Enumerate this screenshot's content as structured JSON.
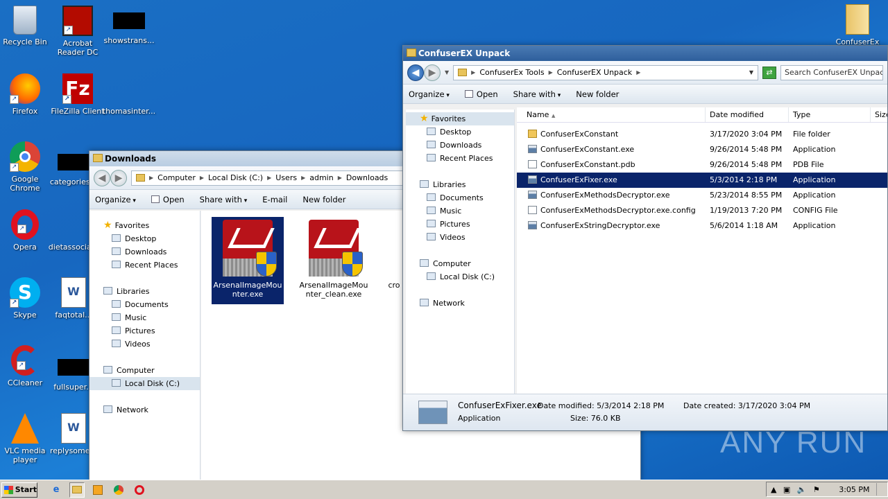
{
  "desktop": {
    "icons": [
      {
        "label": "Recycle Bin"
      },
      {
        "label": "Acrobat Reader DC"
      },
      {
        "label": "showstrans..."
      },
      {
        "label": "Firefox"
      },
      {
        "label": "FileZilla Client"
      },
      {
        "label": "thomasinter..."
      },
      {
        "label": "Google Chrome"
      },
      {
        "label": "categories..."
      },
      {
        "label": "Opera"
      },
      {
        "label": "dietassocia..."
      },
      {
        "label": "Skype"
      },
      {
        "label": "faqtotal..."
      },
      {
        "label": "CCleaner"
      },
      {
        "label": "fullsuper..."
      },
      {
        "label": "VLC media player"
      },
      {
        "label": "replysome..."
      },
      {
        "label": "ConfuserEx"
      }
    ]
  },
  "downloads_window": {
    "title": "Downloads",
    "breadcrumb": [
      "Computer",
      "Local Disk (C:)",
      "Users",
      "admin",
      "Downloads"
    ],
    "toolbar": {
      "organize": "Organize",
      "open": "Open",
      "share_with": "Share with",
      "email": "E-mail",
      "new_folder": "New folder"
    },
    "nav": {
      "favorites": "Favorites",
      "desktop": "Desktop",
      "downloads": "Downloads",
      "recent_places": "Recent Places",
      "libraries": "Libraries",
      "documents": "Documents",
      "music": "Music",
      "pictures": "Pictures",
      "videos": "Videos",
      "computer": "Computer",
      "local_disk": "Local Disk (C:)",
      "network": "Network"
    },
    "files": [
      {
        "name": "ArsenalImageMounter.exe"
      },
      {
        "name": "ArsenalImageMounter_clean.exe"
      },
      {
        "name": "cro"
      }
    ]
  },
  "confuser_window": {
    "title": "ConfuserEX Unpack",
    "breadcrumb": [
      "ConfuserEx Tools",
      "ConfuserEX Unpack"
    ],
    "search_placeholder": "Search ConfuserEX Unpack",
    "toolbar": {
      "organize": "Organize",
      "open": "Open",
      "share_with": "Share with",
      "new_folder": "New folder"
    },
    "nav": {
      "favorites": "Favorites",
      "desktop": "Desktop",
      "downloads": "Downloads",
      "recent_places": "Recent Places",
      "libraries": "Libraries",
      "documents": "Documents",
      "music": "Music",
      "pictures": "Pictures",
      "videos": "Videos",
      "computer": "Computer",
      "local_disk": "Local Disk (C:)",
      "network": "Network"
    },
    "columns": {
      "name": "Name",
      "date_modified": "Date modified",
      "type": "Type",
      "size": "Size"
    },
    "rows": [
      {
        "name": "ConfuserExConstant",
        "date": "3/17/2020 3:04 PM",
        "type": "File folder",
        "icon": "folder-icon"
      },
      {
        "name": "ConfuserExConstant.exe",
        "date": "9/26/2014 5:48 PM",
        "type": "Application",
        "icon": "app-icon"
      },
      {
        "name": "ConfuserExConstant.pdb",
        "date": "9/26/2014 5:48 PM",
        "type": "PDB File",
        "icon": "file-icon"
      },
      {
        "name": "ConfuserExFixer.exe",
        "date": "5/3/2014 2:18 PM",
        "type": "Application",
        "icon": "app-icon",
        "selected": true
      },
      {
        "name": "ConfuserExMethodsDecryptor.exe",
        "date": "5/23/2014 8:55 PM",
        "type": "Application",
        "icon": "app-icon"
      },
      {
        "name": "ConfuserExMethodsDecryptor.exe.config",
        "date": "1/19/2013 7:20 PM",
        "type": "CONFIG File",
        "icon": "file-icon"
      },
      {
        "name": "ConfuserExStringDecryptor.exe",
        "date": "5/6/2014 1:18 AM",
        "type": "Application",
        "icon": "app-icon"
      }
    ],
    "details": {
      "filename": "ConfuserExFixer.exe",
      "type": "Application",
      "date_modified_label": "Date modified:",
      "date_modified": "5/3/2014 2:18 PM",
      "size_label": "Size:",
      "size": "76.0 KB",
      "date_created_label": "Date created:",
      "date_created": "3/17/2020 3:04 PM"
    }
  },
  "taskbar": {
    "start": "Start",
    "clock": "3:05 PM"
  },
  "watermark": "ANY RUN"
}
